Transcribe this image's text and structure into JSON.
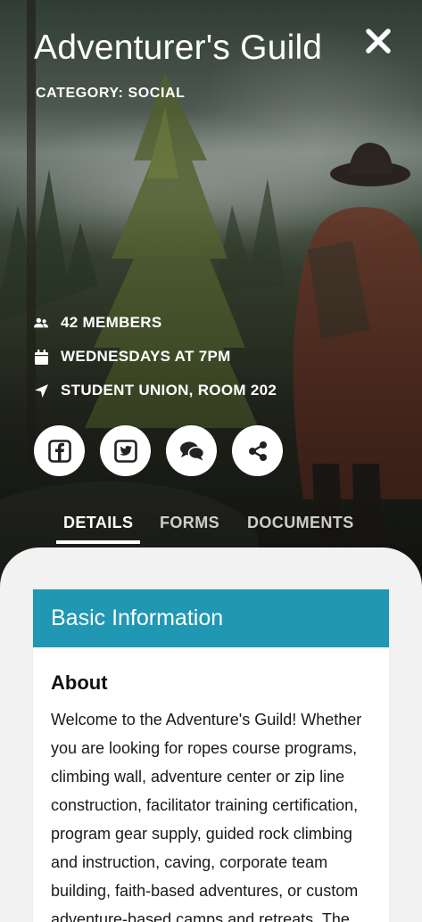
{
  "header": {
    "title": "Adventurer's Guild",
    "category": "CATEGORY: SOCIAL",
    "close_icon": "close-icon"
  },
  "info": {
    "members": "42 MEMBERS",
    "schedule": "WEDNESDAYS AT 7PM",
    "location": "STUDENT UNION, ROOM 202"
  },
  "social": [
    {
      "name": "facebook",
      "icon": "facebook-icon"
    },
    {
      "name": "twitter",
      "icon": "twitter-icon"
    },
    {
      "name": "chat",
      "icon": "chat-icon"
    },
    {
      "name": "share",
      "icon": "share-icon"
    }
  ],
  "tabs": {
    "details": "DETAILS",
    "forms": "FORMS",
    "documents": "DOCUMENTS",
    "active": "DETAILS"
  },
  "card": {
    "header": "Basic Information",
    "about_title": "About",
    "about_text": "Welcome to the Adventure's Guild! Whether you are looking for ropes course programs, climbing wall, adventure center or zip line construction, facilitator training certification, program gear supply, guided rock climbing and instruction, caving, corporate team building, faith-based adventures, or custom adventure-based camps and retreats. The"
  },
  "colors": {
    "accent": "#2097b3",
    "sheet_bg": "#f2f2f2",
    "text_light": "#ffffff"
  }
}
